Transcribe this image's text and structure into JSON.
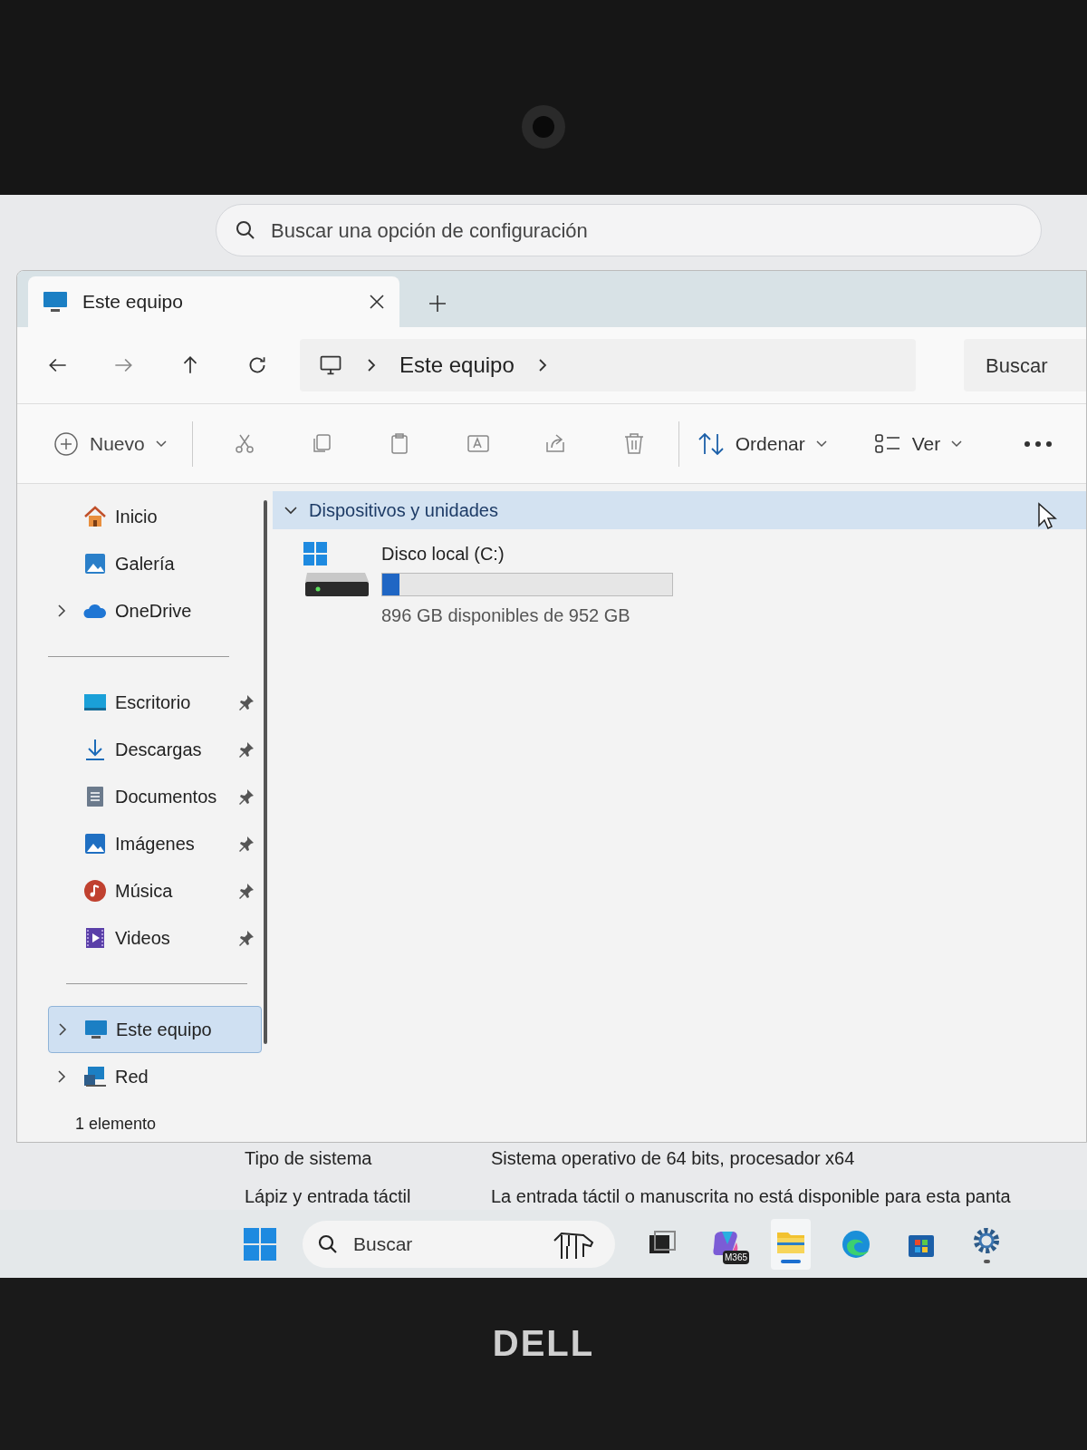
{
  "settings_search": {
    "placeholder": "Buscar una opción de configuración"
  },
  "tabs": [
    {
      "label": "Este equipo",
      "selected": true
    }
  ],
  "breadcrumb": [
    "Este equipo"
  ],
  "address_search": {
    "placeholder": "Buscar"
  },
  "toolbar": {
    "new": "Nuevo",
    "sort": "Ordenar",
    "view": "Ver"
  },
  "sidebar": {
    "groups": [
      {
        "items": [
          {
            "label": "Inicio",
            "pinned": false,
            "selected": false
          },
          {
            "label": "Galería",
            "pinned": false,
            "selected": false
          },
          {
            "label": "OneDrive",
            "expanded": false,
            "pinned": false,
            "selected": false
          }
        ]
      },
      {
        "items": [
          {
            "label": "Escritorio",
            "pinned": true,
            "selected": false
          },
          {
            "label": "Descargas",
            "pinned": true,
            "selected": false
          },
          {
            "label": "Documentos",
            "pinned": true,
            "selected": false
          },
          {
            "label": "Imágenes",
            "pinned": true,
            "selected": false
          },
          {
            "label": "Música",
            "pinned": true,
            "selected": false
          },
          {
            "label": "Videos",
            "pinned": true,
            "selected": false
          }
        ]
      },
      {
        "items": [
          {
            "label": "Este equipo",
            "expanded": false,
            "pinned": false,
            "selected": true
          },
          {
            "label": "Red",
            "expanded": false,
            "pinned": false,
            "selected": false
          }
        ]
      }
    ]
  },
  "section": {
    "label": "Dispositivos y unidades",
    "expanded": true
  },
  "drives": [
    {
      "name": "Disco local (C:)",
      "level": 0.06,
      "free": "896 GB disponibles de 952 GB"
    }
  ],
  "status_bar": "1 elemento",
  "system_info": [
    {
      "label": "Tipo de sistema",
      "value": "Sistema operativo de 64 bits, procesador x64"
    },
    {
      "label": "Lápiz y entrada táctil",
      "value": "La entrada táctil o manuscrita no está disponible para esta panta"
    }
  ],
  "taskbar": {
    "search": {
      "placeholder": "Buscar"
    },
    "apps": [
      {
        "running": false,
        "active": false
      },
      {
        "label": "M365",
        "running": false,
        "active": false
      },
      {
        "running": true,
        "active": true
      },
      {
        "running": false,
        "active": false
      },
      {
        "running": false,
        "active": false
      },
      {
        "running": true,
        "active": false
      }
    ]
  },
  "bezel_logo": "DELL"
}
